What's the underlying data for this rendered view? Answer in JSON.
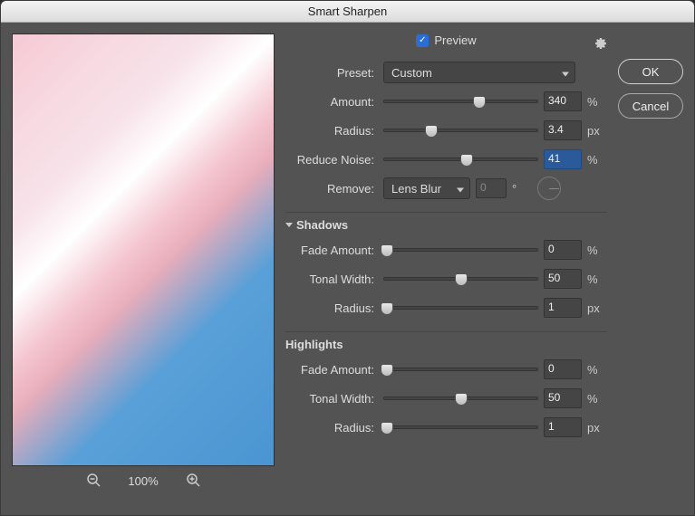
{
  "title": "Smart Sharpen",
  "preview_label": "Preview",
  "preview_checked": true,
  "zoom": "100%",
  "buttons": {
    "ok": "OK",
    "cancel": "Cancel"
  },
  "preset": {
    "label": "Preset:",
    "value": "Custom"
  },
  "amount": {
    "label": "Amount:",
    "value": "340",
    "unit": "%",
    "pos": 62
  },
  "radius": {
    "label": "Radius:",
    "value": "3.4",
    "unit": "px",
    "pos": 31
  },
  "reduce_noise": {
    "label": "Reduce Noise:",
    "value": "41",
    "unit": "%",
    "pos": 54
  },
  "remove": {
    "label": "Remove:",
    "value": "Lens Blur",
    "angle": "0",
    "angle_unit": "°"
  },
  "shadows": {
    "title": "Shadows",
    "fade": {
      "label": "Fade Amount:",
      "value": "0",
      "unit": "%",
      "pos": 2
    },
    "tonal": {
      "label": "Tonal Width:",
      "value": "50",
      "unit": "%",
      "pos": 50
    },
    "radius": {
      "label": "Radius:",
      "value": "1",
      "unit": "px",
      "pos": 2
    }
  },
  "highlights": {
    "title": "Highlights",
    "fade": {
      "label": "Fade Amount:",
      "value": "0",
      "unit": "%",
      "pos": 2
    },
    "tonal": {
      "label": "Tonal Width:",
      "value": "50",
      "unit": "%",
      "pos": 50
    },
    "radius": {
      "label": "Radius:",
      "value": "1",
      "unit": "px",
      "pos": 2
    }
  }
}
